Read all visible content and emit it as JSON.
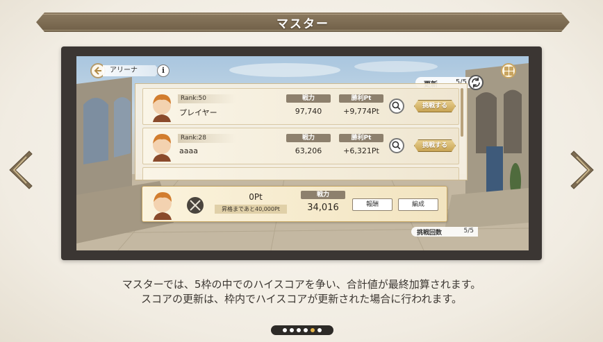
{
  "header": {
    "title": "マスター"
  },
  "arena": {
    "tab_label": "アリーナ",
    "info_label": "i",
    "refresh_label": "更新",
    "refresh_value": "5/5",
    "opponents": [
      {
        "rank": "Rank:50",
        "name": "プレイヤー",
        "power_label": "戦力",
        "power": "97,740",
        "win_label": "勝利Pt",
        "win_pt": "+9,774Pt",
        "challenge_label": "挑戦する"
      },
      {
        "rank": "Rank:28",
        "name": "aaaa",
        "power_label": "戦力",
        "power": "63,206",
        "win_label": "勝利Pt",
        "win_pt": "+6,321Pt",
        "challenge_label": "挑戦する"
      }
    ],
    "player": {
      "points": "0Pt",
      "next_rank": "昇格まであと40,000Pt",
      "power_label": "戦力",
      "power": "34,016",
      "reward_label": "報酬",
      "formation_label": "編成"
    },
    "challenge_count_label": "挑戦回数",
    "challenge_count_value": "5/5"
  },
  "description": {
    "line1": "マスターでは、5枠の中でのハイスコアを争い、合計値が最終加算されます。",
    "line2": "スコアの更新は、枠内でハイスコアが更新された場合に行われます。"
  },
  "pagination": {
    "total": 6,
    "active_index": 4
  },
  "colors": {
    "banner": "#7e6d53",
    "gold": "#c8a454",
    "frame": "#3b3633",
    "text": "#3b3631"
  },
  "icons": [
    "chevron-left-icon",
    "chevron-right-icon",
    "back-arrow-icon",
    "info-icon",
    "grid-icon",
    "refresh-icon",
    "magnifier-icon",
    "crossed-swords-icon"
  ]
}
